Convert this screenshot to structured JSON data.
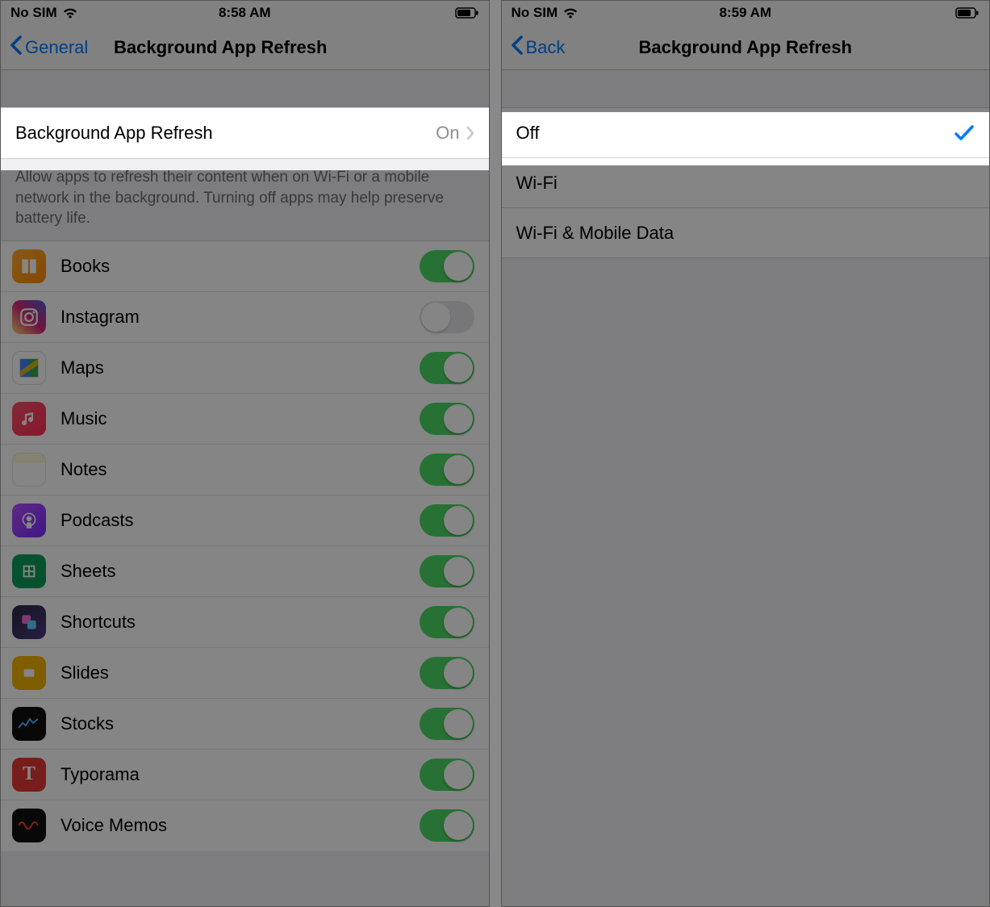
{
  "left": {
    "status": {
      "carrier": "No SIM",
      "time": "8:58 AM"
    },
    "nav": {
      "back": "General",
      "title": "Background App Refresh"
    },
    "master_cell": {
      "label": "Background App Refresh",
      "value": "On"
    },
    "footer": "Allow apps to refresh their content when on Wi-Fi or a mobile network in the background. Turning off apps may help preserve battery life.",
    "apps": [
      {
        "name": "Books",
        "icon": "books-icon",
        "enabled": true
      },
      {
        "name": "Instagram",
        "icon": "instagram-icon",
        "enabled": false
      },
      {
        "name": "Maps",
        "icon": "maps-icon",
        "enabled": true
      },
      {
        "name": "Music",
        "icon": "music-icon",
        "enabled": true
      },
      {
        "name": "Notes",
        "icon": "notes-icon",
        "enabled": true
      },
      {
        "name": "Podcasts",
        "icon": "podcasts-icon",
        "enabled": true
      },
      {
        "name": "Sheets",
        "icon": "sheets-icon",
        "enabled": true
      },
      {
        "name": "Shortcuts",
        "icon": "shortcuts-icon",
        "enabled": true
      },
      {
        "name": "Slides",
        "icon": "slides-icon",
        "enabled": true
      },
      {
        "name": "Stocks",
        "icon": "stocks-icon",
        "enabled": true
      },
      {
        "name": "Typorama",
        "icon": "typorama-icon",
        "enabled": true
      },
      {
        "name": "Voice Memos",
        "icon": "voicememos-icon",
        "enabled": true
      }
    ]
  },
  "right": {
    "status": {
      "carrier": "No SIM",
      "time": "8:59 AM"
    },
    "nav": {
      "back": "Back",
      "title": "Background App Refresh"
    },
    "options": [
      {
        "label": "Off",
        "selected": true
      },
      {
        "label": "Wi-Fi",
        "selected": false
      },
      {
        "label": "Wi-Fi & Mobile Data",
        "selected": false
      }
    ]
  }
}
